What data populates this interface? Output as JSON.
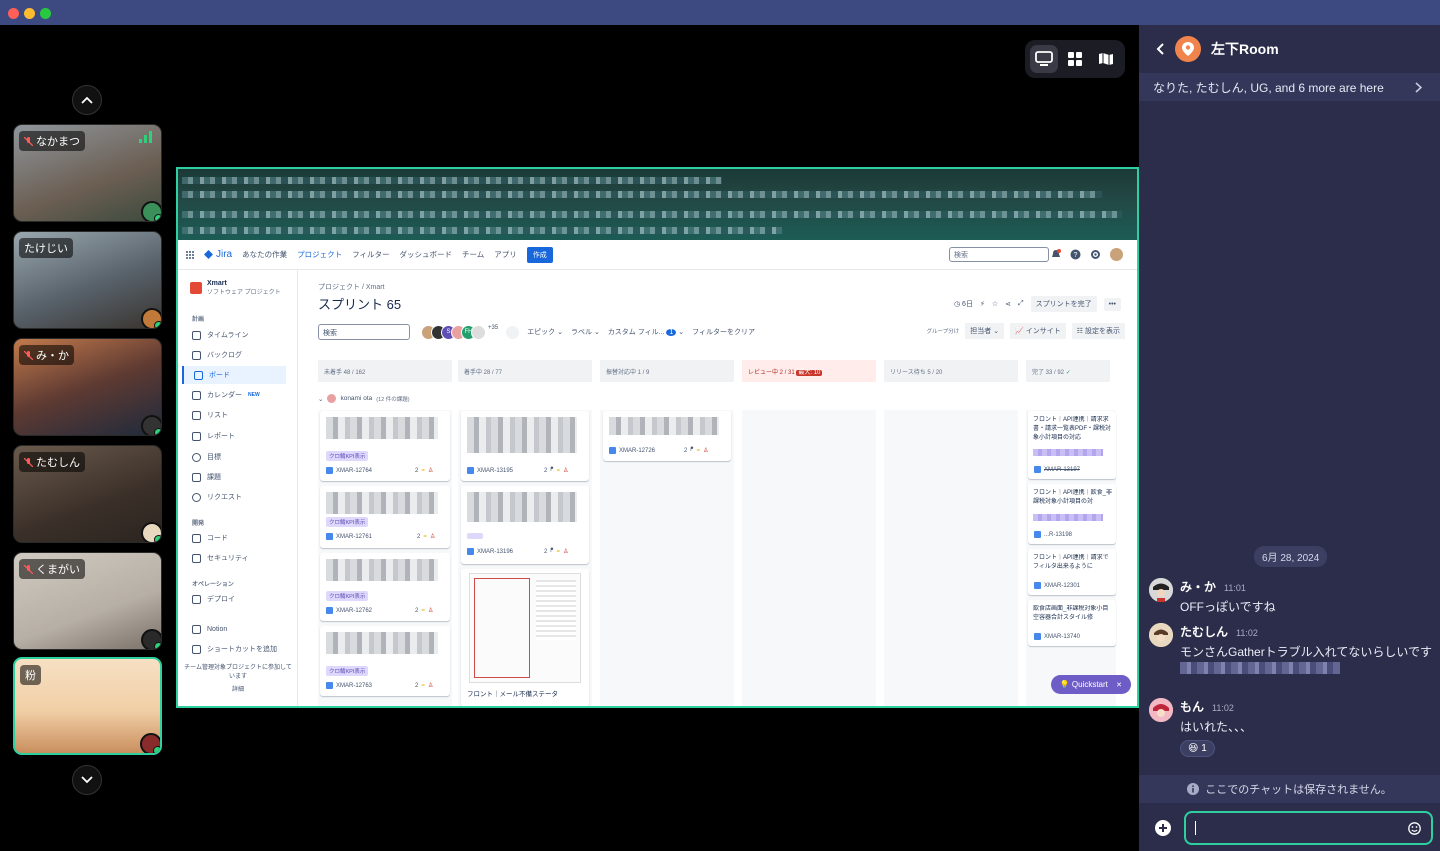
{
  "window": {
    "traffic_lights": [
      "#fe5f57",
      "#febc2e",
      "#28c840"
    ]
  },
  "participants": [
    {
      "name": "なかまつ",
      "muted": true,
      "bg": "#7a7f86"
    },
    {
      "name": "たけじい",
      "muted": false,
      "bg": "#6c7780"
    },
    {
      "name": "み・か",
      "muted": true,
      "bg": "#8c5c48"
    },
    {
      "name": "たむしん",
      "muted": true,
      "bg": "#5a4b3f"
    },
    {
      "name": "くまがい",
      "muted": true,
      "bg": "#b7b0a6"
    },
    {
      "name": "粉",
      "muted": false,
      "bg": "#d9b98e"
    }
  ],
  "jira": {
    "logo": "Jira",
    "nav": [
      "あなたの作業",
      "プロジェクト",
      "フィルター",
      "ダッシュボード",
      "チーム",
      "アプリ"
    ],
    "create": "作成",
    "search_placeholder": "検索",
    "project": {
      "name": "Xmart",
      "type": "ソフトウェア プロジェクト"
    },
    "side_section_plan": "計画",
    "side_items": [
      "タイムライン",
      "バックログ",
      "ボード",
      "カレンダー",
      "リスト",
      "レポート",
      "目標",
      "課題",
      "リクエスト"
    ],
    "calendar_badge": "NEW",
    "side_section_dev": "開発",
    "side_dev": [
      "コード",
      "セキュリティ"
    ],
    "side_section_ops": "オペレーション",
    "side_ops": [
      "デプロイ"
    ],
    "side_bottom": [
      "Notion",
      "ショートカットを追加"
    ],
    "side_note": "チーム管理対象プロジェクトに参加しています",
    "side_more": "詳細",
    "breadcrumb": "プロジェクト  /  Xmart",
    "sprint_title": "スプリント 65",
    "days_left": "6日",
    "complete_sprint": "スプリントを完了",
    "board_search": "検索",
    "avatar_more": "+35",
    "filters": [
      "エピック",
      "ラベル",
      "カスタム フィル..."
    ],
    "custom_filter_count": "1",
    "clear_filters": "フィルターをクリア",
    "group_by": "グループ分け",
    "assignee": "担当者",
    "insight": "インサイト",
    "show_settings": "設定を表示",
    "columns": [
      "未着手 48 / 162",
      "着手中 28 / 77",
      "振替対応中 1 / 9",
      "レビュー中 2 / 31",
      "リリース待ち 5 / 20",
      "完了 33 / 92"
    ],
    "review_badge": "最大: 10",
    "swimlane": "konami ota",
    "swimlane_count": "(12 件の課題)",
    "card_tag": "クロ鯖KPI表示",
    "col1_keys": [
      "XMAR-12764",
      "XMAR-12761",
      "XMAR-12762",
      "XMAR-12763"
    ],
    "col2_keys": [
      "XMAR-13195",
      "XMAR-13196"
    ],
    "col2_bottom": "フロント｜メール不備ステータ",
    "col3_key": "XMAR-12726",
    "done_cards": [
      {
        "text": "フロント｜API連携｜請求求書・請求一覧表PDF・課税対象小計項目の対応",
        "key": "XMAR-13197"
      },
      {
        "text": "フロント｜API連携｜飲食_非課税対象小計項目の対",
        "key": "...R-13198"
      },
      {
        "text": "フロント｜API連携｜請求でフィルタ出来るように",
        "key": "XMAR-12301"
      },
      {
        "text": "飲食店画面_非課税対象小目 空容器合計スタイル修",
        "key": "XMAR-13740"
      }
    ],
    "story_points": "2",
    "quickstart": "Quickstart"
  },
  "chat": {
    "room_title": "左下Room",
    "here_text": "なりた, たむしん, UG, and 6 more are here",
    "date": "6月 28, 2024",
    "messages": [
      {
        "name": "み・か",
        "time": "11:01",
        "text": "OFFっぽいですね"
      },
      {
        "name": "たむしん",
        "time": "11:02",
        "text": "モンさんGatherトラブル入れてないらしいです"
      },
      {
        "name": "もん",
        "time": "11:02",
        "text": "はいれた、、、"
      }
    ],
    "reaction": {
      "emoji": "😆",
      "count": "1"
    },
    "notice": "ここでのチャットは保存されません。"
  }
}
